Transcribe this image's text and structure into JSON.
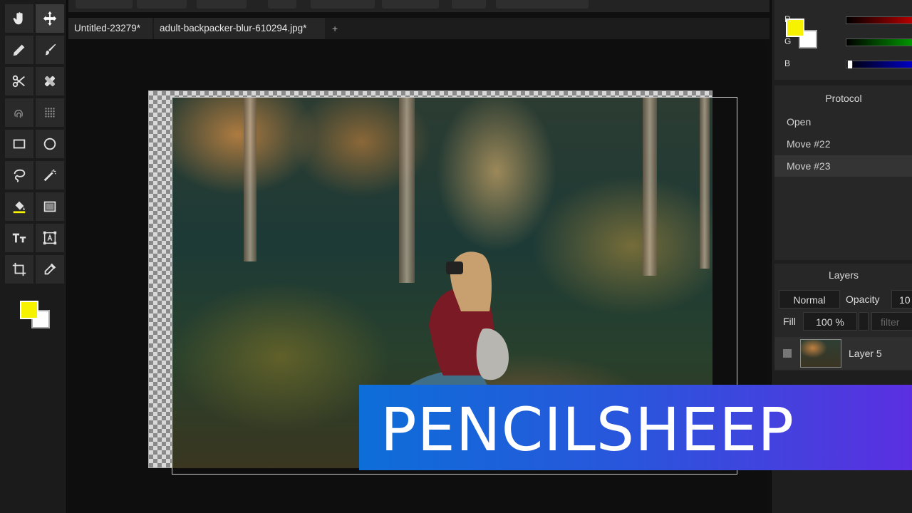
{
  "tabs": [
    {
      "label": "Untitled-23279*"
    },
    {
      "label": "adult-backpacker-blur-610294.jpg*"
    }
  ],
  "tab_add": "+",
  "toolbar": {
    "tools": [
      "hand-icon",
      "move-icon",
      "pencil-icon",
      "brush-icon",
      "scissors-icon",
      "healing-icon",
      "fingerprint-icon",
      "grid-icon",
      "rectangle-icon",
      "ellipse-icon",
      "lasso-icon",
      "magic-wand-icon",
      "fill-bucket-icon",
      "gradient-icon",
      "text-icon",
      "transform-icon",
      "crop-icon",
      "eyedropper-icon"
    ],
    "fg_color": "#f6f200",
    "bg_color": "#ffffff"
  },
  "right_panel": {
    "color": {
      "r_label": "R",
      "g_label": "G",
      "b_label": "B",
      "fg_color": "#f6f200",
      "bg_color": "#ffffff"
    },
    "protocol": {
      "title": "Protocol",
      "items": [
        "Open",
        "Move #22",
        "Move #23"
      ],
      "selected": "Move #23"
    },
    "layers": {
      "title": "Layers",
      "blend_mode": "Normal",
      "opacity_label": "Opacity",
      "opacity_value": "10",
      "fill_label": "Fill",
      "fill_value": "100 %",
      "filter_placeholder": "filter",
      "layer_name": "Layer 5"
    }
  },
  "banner": {
    "text": "PENCILSHEEP"
  }
}
